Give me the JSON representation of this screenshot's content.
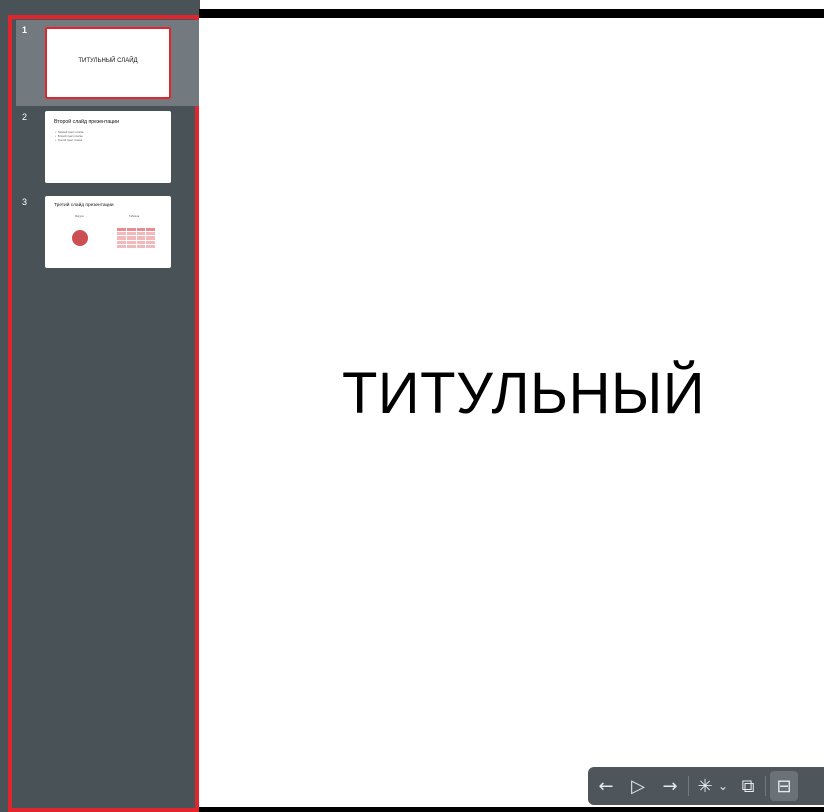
{
  "slides": [
    {
      "number": "1",
      "title": "ТИТУЛЬНЫЙ СЛАЙД"
    },
    {
      "number": "2",
      "title": "Второй слайд презентации",
      "bullets": [
        "Первый пункт списка",
        "Второй пункт списка",
        "Третий пункт списка"
      ]
    },
    {
      "number": "3",
      "title": "Третий слайд презентации",
      "left_label": "Фигура",
      "right_label": "Таблица"
    }
  ],
  "current_slide": {
    "title": "ТИТУЛЬНЫЙ"
  },
  "toolbar": {
    "prev_icon": "←",
    "play_icon": "▷",
    "next_icon": "→",
    "laser_icon": "✳",
    "chevron_icon": "⌄",
    "overlay_icon": "⧉",
    "layout_icon": "⊟"
  },
  "colors": {
    "sidebar": "#495257",
    "selection_border": "#e0252c",
    "toolbar": "#4e565c"
  }
}
